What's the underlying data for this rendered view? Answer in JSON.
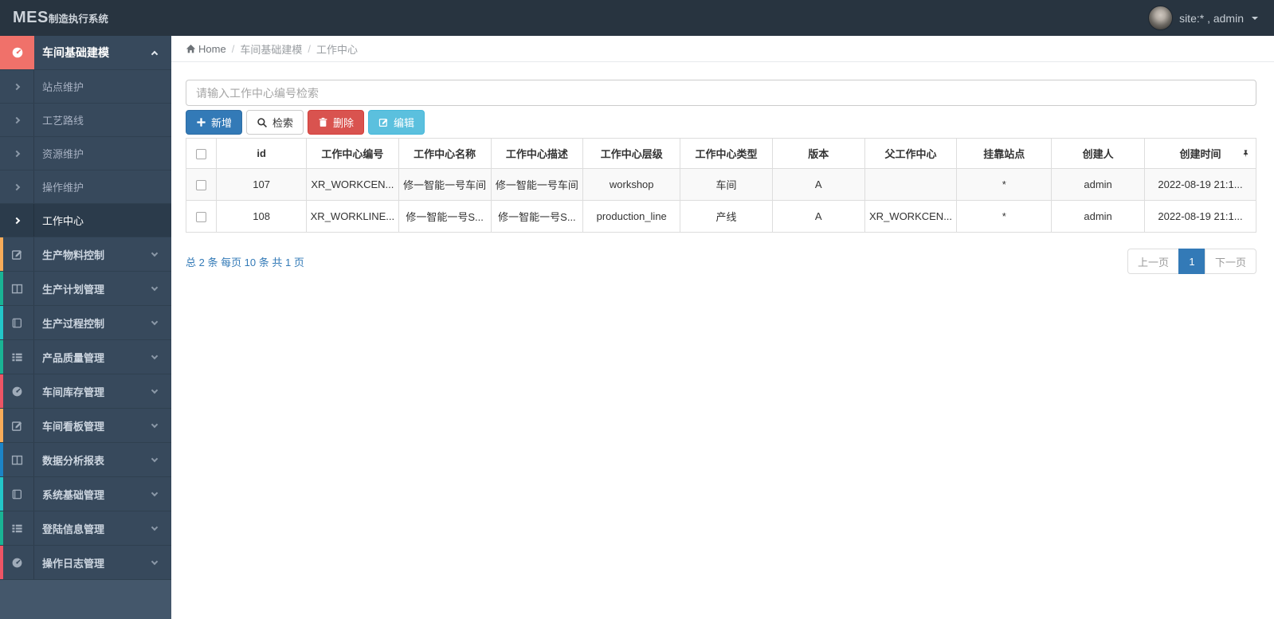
{
  "topbar": {
    "logo_primary": "MES",
    "logo_secondary": "制造执行系统",
    "user_label": "site:* , admin"
  },
  "breadcrumb": {
    "items": [
      "Home",
      "车间基础建模",
      "工作中心"
    ]
  },
  "sidebar": {
    "parent": {
      "label": "车间基础建模",
      "icon": "tachometer-icon",
      "icon_bg": "#f0716a"
    },
    "submenu": [
      {
        "label": "站点维护",
        "active": false
      },
      {
        "label": "工艺路线",
        "active": false
      },
      {
        "label": "资源维护",
        "active": false
      },
      {
        "label": "操作维护",
        "active": false
      },
      {
        "label": "工作中心",
        "active": true
      }
    ],
    "groups": [
      {
        "label": "生产物料控制",
        "icon": "edit-icon",
        "strip_color": "#f8ac59"
      },
      {
        "label": "生产计划管理",
        "icon": "columns-icon",
        "strip_color": "#1ab394"
      },
      {
        "label": "生产过程控制",
        "icon": "book-icon",
        "strip_color": "#23c6c8"
      },
      {
        "label": "产品质量管理",
        "icon": "th-list-icon",
        "strip_color": "#1ab394"
      },
      {
        "label": "车间库存管理",
        "icon": "tachometer-icon",
        "strip_color": "#ed5565"
      },
      {
        "label": "车间看板管理",
        "icon": "edit-icon",
        "strip_color": "#f8ac59"
      },
      {
        "label": "数据分析报表",
        "icon": "columns-icon",
        "strip_color": "#1c84c6"
      },
      {
        "label": "系统基础管理",
        "icon": "book-icon",
        "strip_color": "#23c6c8"
      },
      {
        "label": "登陆信息管理",
        "icon": "th-list-icon",
        "strip_color": "#1ab394"
      },
      {
        "label": "操作日志管理",
        "icon": "tachometer-icon",
        "strip_color": "#ed5565"
      }
    ]
  },
  "search": {
    "placeholder": "请输入工作中心编号检索",
    "value": ""
  },
  "toolbar": {
    "add_label": "新增",
    "search_label": "检索",
    "delete_label": "删除",
    "edit_label": "编辑"
  },
  "table": {
    "columns": [
      "id",
      "工作中心编号",
      "工作中心名称",
      "工作中心描述",
      "工作中心层级",
      "工作中心类型",
      "版本",
      "父工作中心",
      "挂靠站点",
      "创建人",
      "创建时间"
    ],
    "rows": [
      [
        "107",
        "XR_WORKCEN...",
        "修一智能一号车间",
        "修一智能一号车间",
        "workshop",
        "车间",
        "A",
        "",
        "*",
        "admin",
        "2022-08-19 21:1..."
      ],
      [
        "108",
        "XR_WORKLINE...",
        "修一智能一号S...",
        "修一智能一号S...",
        "production_line",
        "产线",
        "A",
        "XR_WORKCEN...",
        "*",
        "admin",
        "2022-08-19 21:1..."
      ]
    ]
  },
  "pagination": {
    "summary": "总 2 条 每页 10 条 共 1 页",
    "prev_label": "上一页",
    "current_page": "1",
    "next_label": "下一页"
  },
  "colors": {
    "topbar_bg": "#283440",
    "sidebar_bg": "#44576b",
    "sidebar_row_bg": "#37495c",
    "sidebar_active_bg": "#2b3b4b",
    "parent_icon_bg": "#f0716a",
    "primary_blue": "#337ab7",
    "danger_red": "#d9534f",
    "info_blue": "#5bc0de",
    "link_blue": "#337ab7"
  }
}
